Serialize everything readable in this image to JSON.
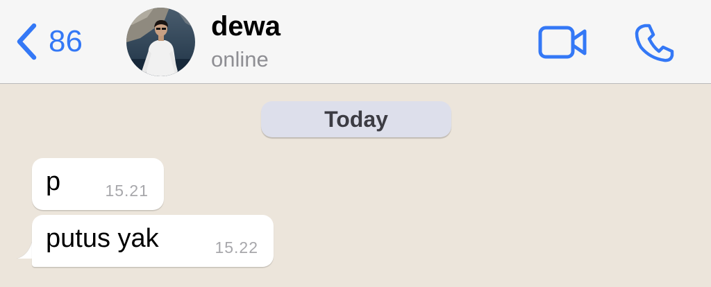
{
  "header": {
    "back_count": "86",
    "contact_name": "dewa",
    "contact_status": "online",
    "accent_color": "#3478f6"
  },
  "icons": {
    "back": "chevron-left-icon",
    "video": "video-camera-icon",
    "call": "phone-icon"
  },
  "chat": {
    "date_label": "Today",
    "background_color": "#ece5db",
    "messages": [
      {
        "text": "p",
        "time": "15.21",
        "direction": "incoming"
      },
      {
        "text": "putus yak",
        "time": "15.22",
        "direction": "incoming"
      }
    ]
  }
}
